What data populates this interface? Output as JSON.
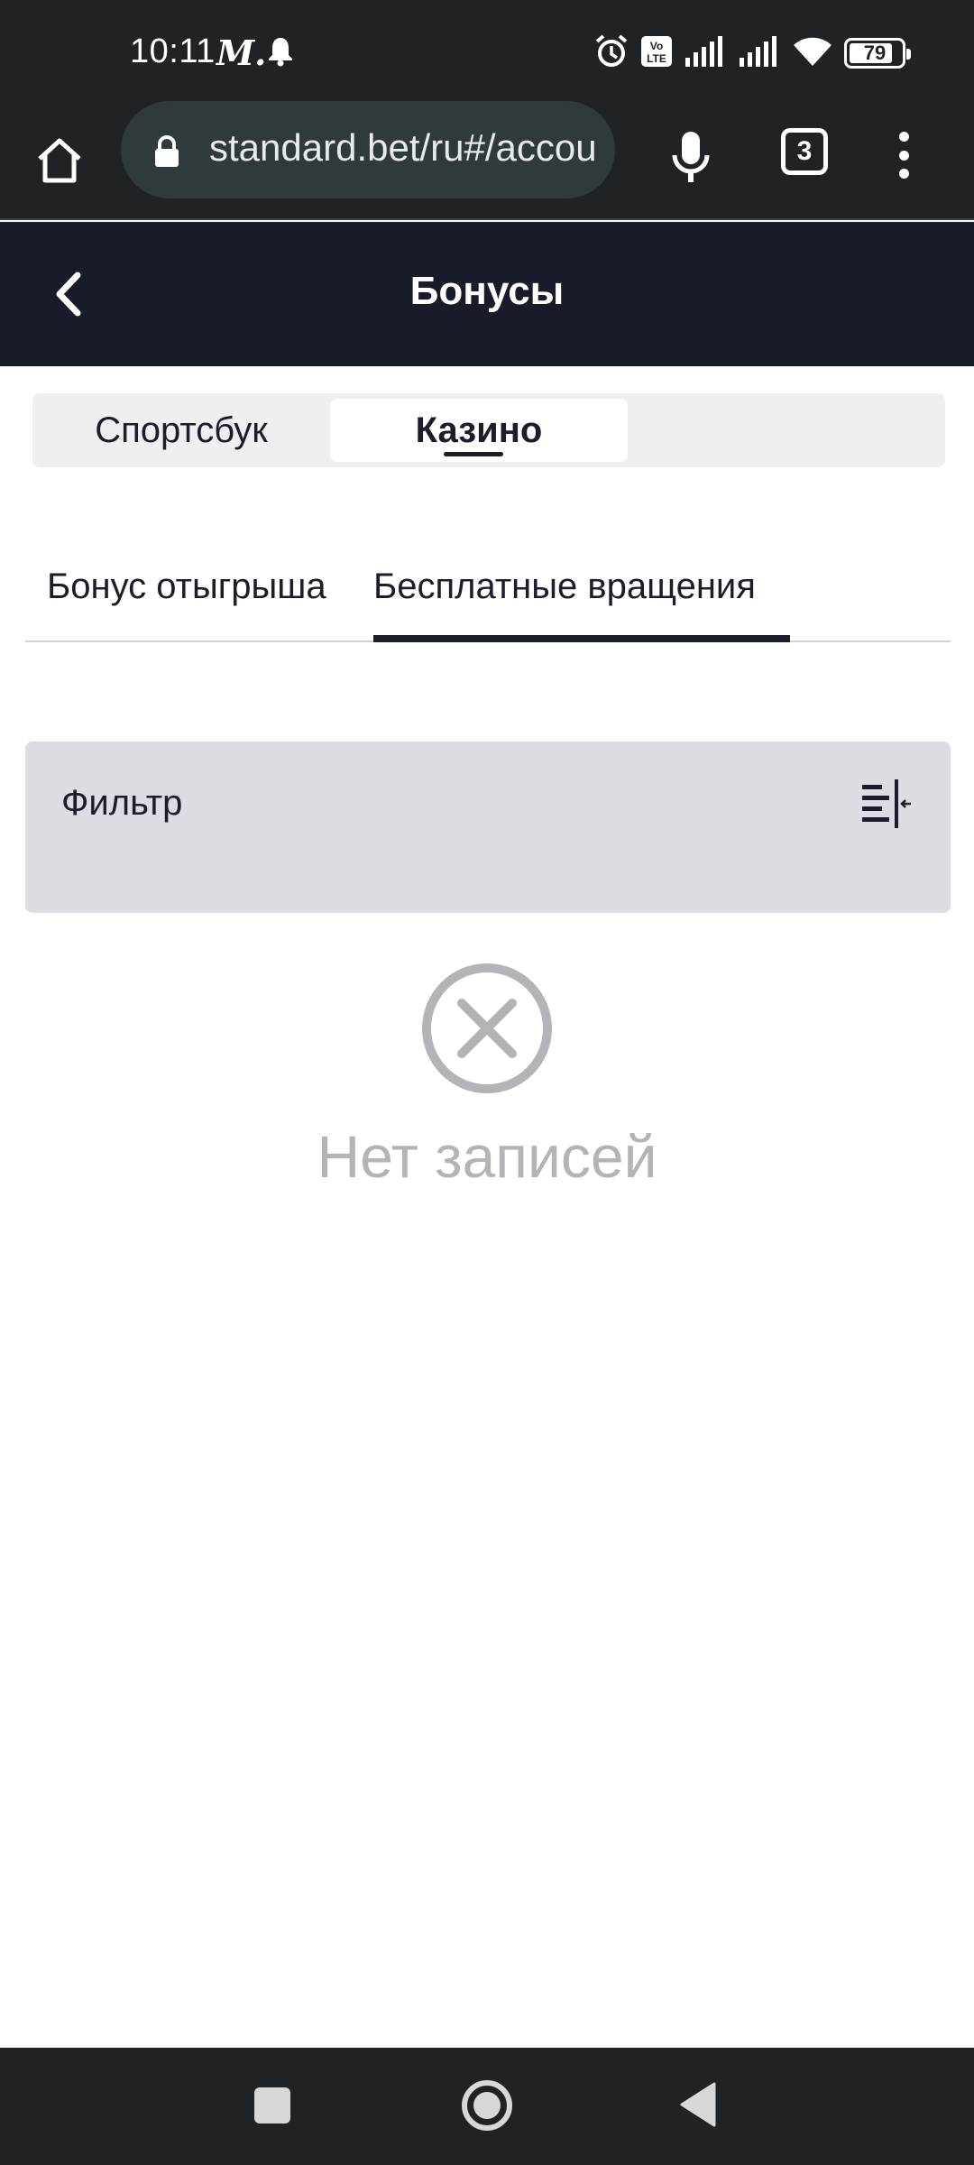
{
  "status_bar": {
    "time": "10:11",
    "carrier_mark": "M.",
    "battery": "79",
    "icons": [
      "bell-icon",
      "alarm-icon",
      "volte-icon",
      "signal-icon",
      "signal-icon",
      "wifi-icon",
      "battery-icon"
    ]
  },
  "browser": {
    "url": "standard.bet/ru#/account",
    "tab_count": "3",
    "icons": [
      "home-icon",
      "lock-icon",
      "mic-icon",
      "tabs-icon",
      "more-icon"
    ]
  },
  "header": {
    "title": "Бонусы",
    "back_icon": "chevron-left-icon"
  },
  "segment": {
    "items": [
      "Спортсбук",
      "Казино"
    ],
    "active": "Казино"
  },
  "subtabs": {
    "items": [
      "Бонус отыгрыша",
      "Бесплатные вращения"
    ],
    "active": "Бесплатные вращения"
  },
  "filter": {
    "label": "Фильтр",
    "icon": "filter-collapse-icon"
  },
  "empty_state": {
    "icon": "close-circle-icon",
    "text": "Нет записей"
  },
  "nav": {
    "icons": [
      "recents-icon",
      "home-circle-icon",
      "back-triangle-icon"
    ]
  },
  "colors": {
    "status_bg": "#1f2326",
    "header_bg": "#181c2a",
    "filter_bg": "#dcdce3",
    "segment_bg": "#efeff1",
    "muted_text": "#b3b3b8"
  }
}
